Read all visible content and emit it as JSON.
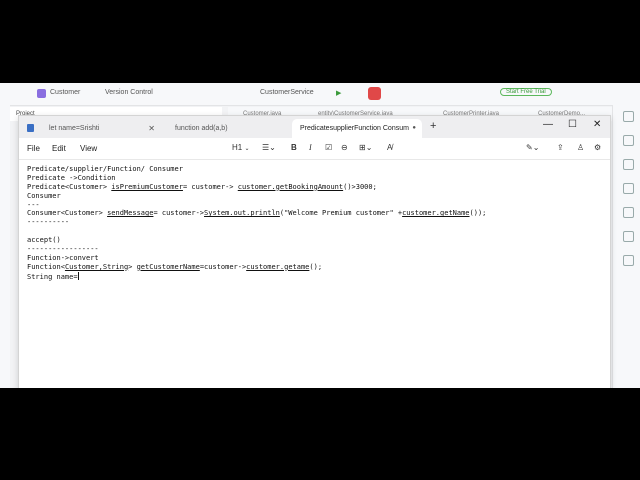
{
  "ide": {
    "project": "Customer",
    "vcs": "Version Control",
    "run_config": "CustomerService",
    "trial_button": "Start Free Trial",
    "left_header": "Project",
    "tabs": [
      "Customer.java",
      "entity\\CustomerService.java",
      "CustomerPrinter.java",
      "CustomerDemo..."
    ]
  },
  "notepad": {
    "tabs": [
      {
        "label": "let name=Srishti",
        "active": false
      },
      {
        "label": "function add(a,b)",
        "active": false
      },
      {
        "label": "PredicatesupplierFunction Consum",
        "active": true
      }
    ],
    "menu": [
      "File",
      "Edit",
      "View"
    ],
    "toolbar": {
      "heading": "H1",
      "bold": "B",
      "italic": "I"
    },
    "window_controls": {
      "minimize": "—",
      "maximize": "☐",
      "close": "✕"
    }
  },
  "document": {
    "lines": [
      [
        {
          "t": "Predicate/supplier/Function/ Consumer"
        }
      ],
      [
        {
          "t": "Predicate ->Condition"
        }
      ],
      [
        {
          "t": "Predicate<Customer> "
        },
        {
          "t": "isPremiumCustomer",
          "u": true
        },
        {
          "t": "= customer-> "
        },
        {
          "t": "customer.getBookingAmount",
          "u": true
        },
        {
          "t": "()>3000;"
        }
      ],
      [
        {
          "t": "Consumer"
        }
      ],
      [
        {
          "t": "---"
        }
      ],
      [
        {
          "t": "Consumer<Customer> "
        },
        {
          "t": "sendMessage",
          "u": true
        },
        {
          "t": "= customer->"
        },
        {
          "t": "System.out.println",
          "u": true
        },
        {
          "t": "(\"Welcome Premium customer\" +"
        },
        {
          "t": "customer.getName",
          "u": true
        },
        {
          "t": "());"
        }
      ],
      [
        {
          "t": "----------"
        }
      ],
      [
        {
          "t": ""
        }
      ],
      [
        {
          "t": "accept()"
        }
      ],
      [
        {
          "t": "-----------------"
        }
      ],
      [
        {
          "t": "Function->convert"
        }
      ],
      [
        {
          "t": "Function<"
        },
        {
          "t": "Customer,String",
          "u": true
        },
        {
          "t": "> "
        },
        {
          "t": "getCustomerName",
          "u": true
        },
        {
          "t": "=customer->"
        },
        {
          "t": "customer.getame",
          "u": true
        },
        {
          "t": "();"
        }
      ],
      [
        {
          "t": "String name="
        }
      ]
    ]
  }
}
